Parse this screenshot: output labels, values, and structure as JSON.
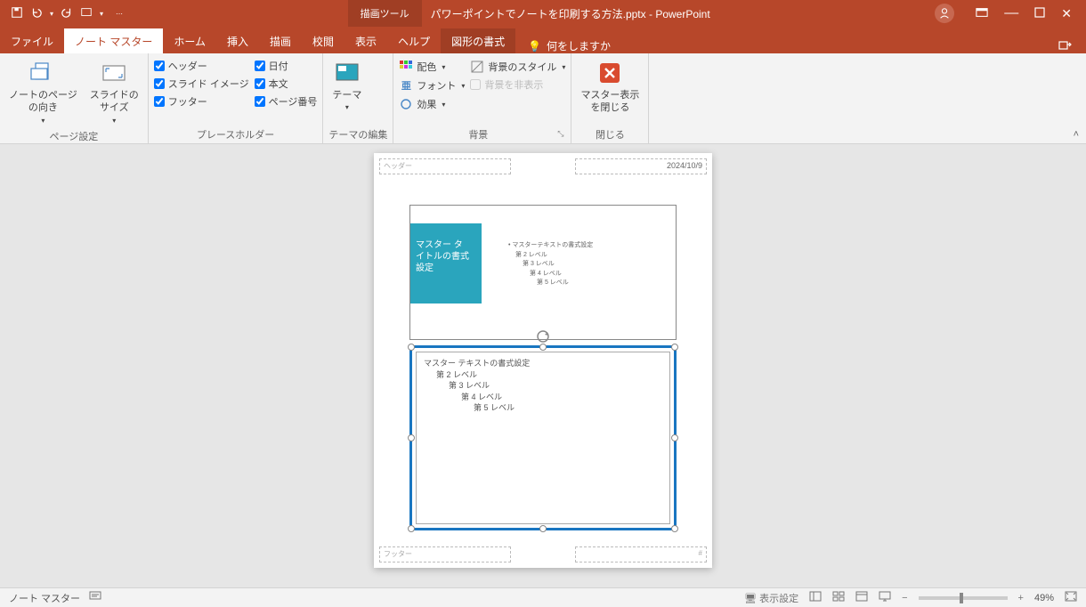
{
  "titlebar": {
    "tool_context": "描画ツール",
    "filename": "パワーポイントでノートを印刷する方法.pptx",
    "app": "PowerPoint"
  },
  "tabs": {
    "file": "ファイル",
    "notes_master": "ノート マスター",
    "home": "ホーム",
    "insert": "挿入",
    "draw": "描画",
    "review": "校閲",
    "view": "表示",
    "help": "ヘルプ",
    "shape_format": "図形の書式",
    "search": "何をしますか"
  },
  "ribbon": {
    "page_setup": {
      "notes_orientation": "ノートのページ\nの向き",
      "slide_size": "スライドの\nサイズ",
      "group": "ページ設定"
    },
    "placeholders": {
      "header": "ヘッダー",
      "slide_image": "スライド イメージ",
      "footer": "フッター",
      "date": "日付",
      "body": "本文",
      "page_number": "ページ番号",
      "group": "プレースホルダー"
    },
    "theme": {
      "themes": "テーマ",
      "group": "テーマの編集"
    },
    "background": {
      "colors": "配色",
      "fonts": "フォント",
      "effects": "効果",
      "bg_styles": "背景のスタイル",
      "hide_bg": "背景を非表示",
      "group": "背景"
    },
    "close": {
      "close_master": "マスター表示\nを閉じる",
      "group": "閉じる"
    }
  },
  "page": {
    "header_ph": "ヘッダー",
    "date": "2024/10/9",
    "footer_ph": "フッター",
    "pagenum_ph": "#",
    "slide_title": "マスター タ\nイトルの書式\n設定",
    "slide_levels": [
      "マスターテキストの書式設定",
      "第 2 レベル",
      "第 3 レベル",
      "第 4 レベル",
      "第 5 レベル"
    ],
    "notes_levels": [
      "マスター テキストの書式設定",
      "第 2 レベル",
      "第 3 レベル",
      "第 4 レベル",
      "第 5 レベル"
    ]
  },
  "status": {
    "mode": "ノート マスター",
    "display_settings": "表示設定",
    "zoom": "49%"
  }
}
